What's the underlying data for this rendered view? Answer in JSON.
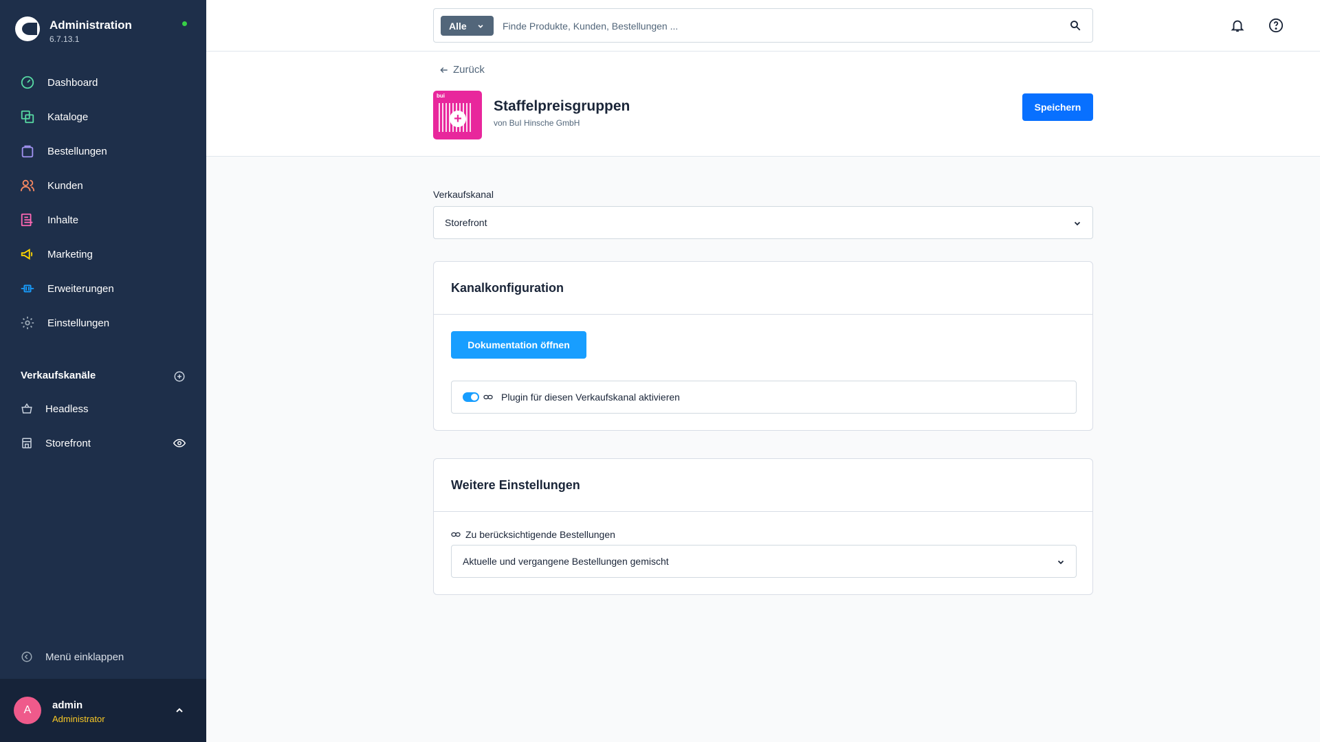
{
  "app": {
    "title": "Administration",
    "version": "6.7.13.1",
    "status_color": "#37d046"
  },
  "sidebar": {
    "items": [
      {
        "label": "Dashboard",
        "icon": "dashboard-icon",
        "color": "#57d9a3"
      },
      {
        "label": "Kataloge",
        "icon": "catalog-icon",
        "color": "#57d9a3"
      },
      {
        "label": "Bestellungen",
        "icon": "shopping-bag-icon",
        "color": "#a092f0"
      },
      {
        "label": "Kunden",
        "icon": "customers-icon",
        "color": "#f88962"
      },
      {
        "label": "Inhalte",
        "icon": "content-icon",
        "color": "#ff68b4"
      },
      {
        "label": "Marketing",
        "icon": "megaphone-icon",
        "color": "#ffd700"
      },
      {
        "label": "Erweiterungen",
        "icon": "plug-icon",
        "color": "#189eff"
      },
      {
        "label": "Einstellungen",
        "icon": "gear-icon",
        "color": "#9aa8b5"
      }
    ],
    "channels_title": "Verkaufskanäle",
    "channels": [
      {
        "label": "Headless",
        "icon": "basket-icon"
      },
      {
        "label": "Storefront",
        "icon": "storefront-icon"
      }
    ],
    "collapse_label": "Menü einklappen"
  },
  "user": {
    "initial": "A",
    "name": "admin",
    "role": "Administrator"
  },
  "search": {
    "type_label": "Alle",
    "placeholder": "Finde Produkte, Kunden, Bestellungen ..."
  },
  "header": {
    "back_label": "Zurück",
    "plugin_badge": "bui",
    "title": "Staffelpreisgruppen",
    "subtitle": "von BuI Hinsche GmbH",
    "save_label": "Speichern"
  },
  "sales_channel": {
    "label": "Verkaufskanal",
    "value": "Storefront"
  },
  "channel_config": {
    "title": "Kanalkonfiguration",
    "doc_button": "Dokumentation öffnen",
    "toggle_label": "Plugin für diesen Verkaufskanal aktivieren",
    "toggle_on": true
  },
  "more_settings": {
    "title": "Weitere Einstellungen",
    "field_label": "Zu berücksichtigende Bestellungen",
    "field_value": "Aktuelle und vergangene Bestellungen gemischt"
  },
  "colors": {
    "sidebar_bg": "#1e2f4a",
    "primary": "#0870ff",
    "accent": "#189eff",
    "plugin_brand": "#e8279c"
  }
}
